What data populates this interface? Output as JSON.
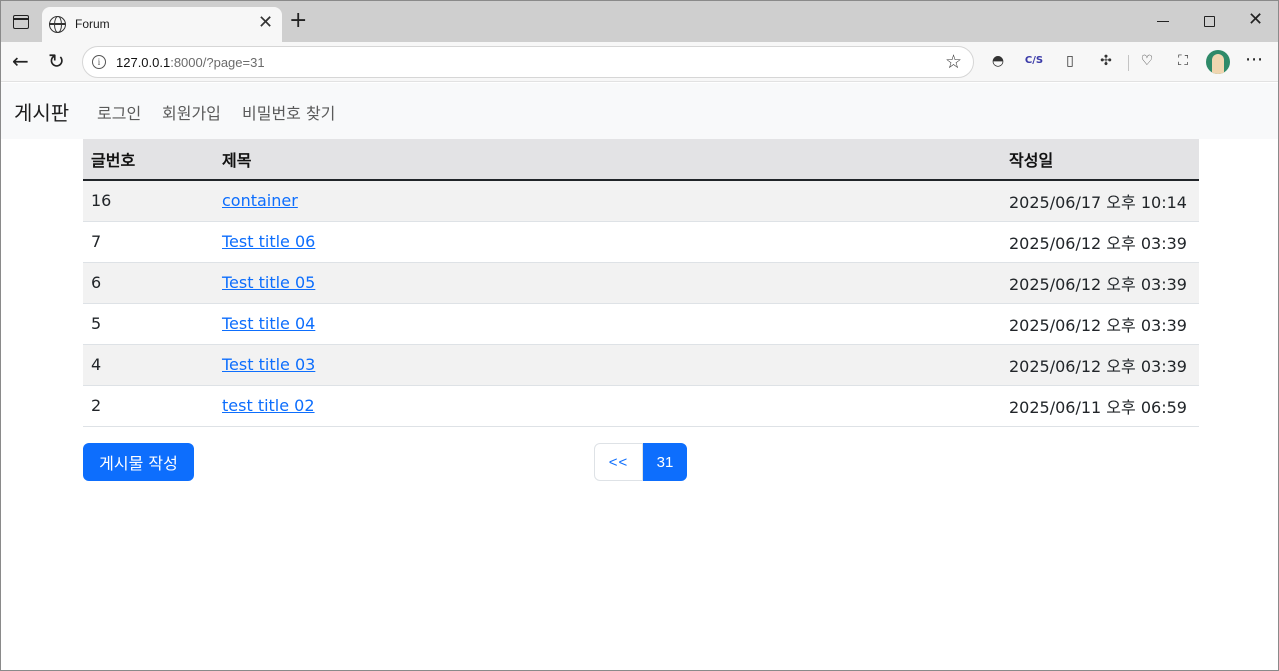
{
  "browser": {
    "tab_title": "Forum",
    "url_host": "127.0.0.1",
    "url_rest": ":8000/?page=31",
    "extension_2_label": "C/S"
  },
  "navbar": {
    "brand": "게시판",
    "links": [
      "로그인",
      "회원가입",
      "비밀번호 찾기"
    ]
  },
  "table": {
    "headers": [
      "글번호",
      "제목",
      "작성일"
    ],
    "rows": [
      {
        "num": "16",
        "title": "container",
        "date": "2025/06/17 오후 10:14"
      },
      {
        "num": "7",
        "title": "Test title 06",
        "date": "2025/06/12 오후 03:39"
      },
      {
        "num": "6",
        "title": "Test title 05",
        "date": "2025/06/12 오후 03:39"
      },
      {
        "num": "5",
        "title": "Test title 04",
        "date": "2025/06/12 오후 03:39"
      },
      {
        "num": "4",
        "title": "Test title 03",
        "date": "2025/06/12 오후 03:39"
      },
      {
        "num": "2",
        "title": "test title 02",
        "date": "2025/06/11 오후 06:59"
      }
    ]
  },
  "actions": {
    "write_label": "게시물 작성"
  },
  "pagination": {
    "prev_label": "<<",
    "current_page": "31"
  },
  "colors": {
    "primary": "#0d6efd",
    "navbar_bg": "#f8f9fa",
    "header_bg": "#e3e3e5",
    "striped_row": "#f2f2f2"
  }
}
